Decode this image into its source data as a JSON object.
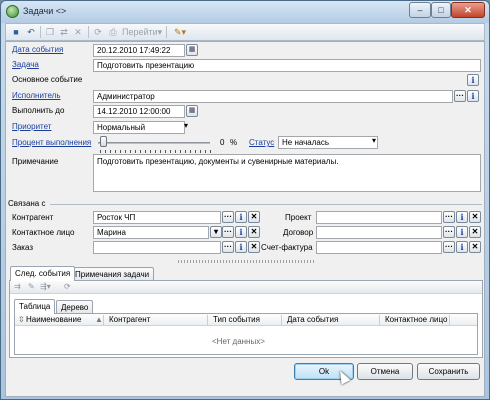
{
  "window": {
    "title": "Задачи <>",
    "controls": {
      "minimize": "–",
      "maximize": "□",
      "close": "✕"
    }
  },
  "toolbar": {
    "save_icon": "save-icon",
    "undo_icon": "undo-icon",
    "goto_label": "Перейти",
    "goto_arrow": "▾"
  },
  "form": {
    "event_date": {
      "label": "Дата события",
      "value": "20.12.2010 17:49:22"
    },
    "task": {
      "label": "Задача",
      "value": "Подготовить презентацию"
    },
    "base_event": {
      "label": "Основное событие",
      "value": ""
    },
    "executor": {
      "label": "Исполнитель",
      "value": "Администратор"
    },
    "due": {
      "label": "Выполнить до",
      "value": "14.12.2010 12:00:00"
    },
    "priority": {
      "label": "Приоритет",
      "value": "Нормальный"
    },
    "progress": {
      "label": "Процент выполнения",
      "value": "0",
      "unit": "%",
      "percent": 0
    },
    "status": {
      "label": "Статус",
      "value": "Не началась"
    },
    "note": {
      "label": "Примечание",
      "value": "Подготовить презентацию, документы и сувенирные материалы."
    }
  },
  "related": {
    "group_label": "Связана с",
    "contractor": {
      "label": "Контрагент",
      "value": "Росток ЧП"
    },
    "contact": {
      "label": "Контактное лицо",
      "value": "Марина"
    },
    "order": {
      "label": "Заказ",
      "value": ""
    },
    "project": {
      "label": "Проект",
      "value": ""
    },
    "contract": {
      "label": "Договор",
      "value": ""
    },
    "invoice": {
      "label": "Счет-фактура",
      "value": ""
    }
  },
  "tabs": {
    "next_events": "След. события",
    "task_notes": "Примечания задачи"
  },
  "subtabs": {
    "table": "Таблица",
    "tree": "Дерево"
  },
  "grid": {
    "columns": [
      "Наименование",
      "Контрагент",
      "Тип события",
      "Дата события",
      "Контактное лицо"
    ],
    "empty": "<Нет данных>"
  },
  "buttons": {
    "ok": "Ok",
    "cancel": "Отмена",
    "save": "Сохранить"
  },
  "glyphs": {
    "dots": "···",
    "info": "i",
    "clear": "✕",
    "dropdown": "▾",
    "calendar": "▦"
  }
}
